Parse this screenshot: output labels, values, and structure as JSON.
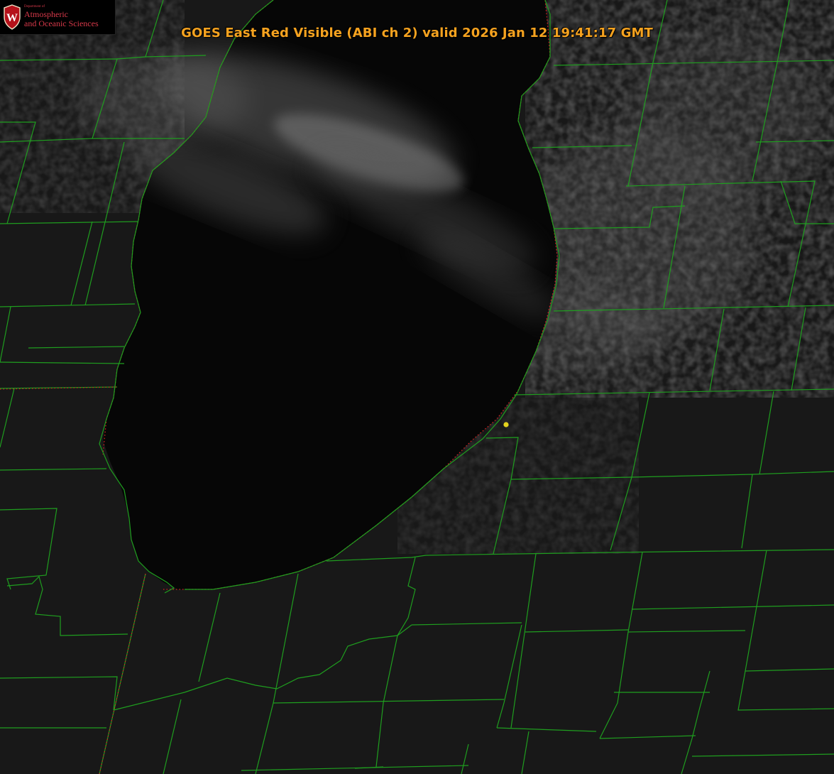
{
  "title": "GOES East Red Visible (ABI ch 2) valid 2026 Jan 12 19:41:17 GMT",
  "logo": {
    "crest_letter": "W",
    "department": "Department of",
    "line1": "Atmospheric",
    "line2": "and Oceanic Sciences"
  },
  "colors": {
    "title": "#f5a21f",
    "boundaries": "#1f9e1f",
    "shoreline_dotted": "#d81f1f",
    "marker": "#e3d21e",
    "logo_text": "#d8394a",
    "crest": "#b5121b",
    "land": "#181818",
    "lake": "#060606",
    "clouds": "#9a9a9a"
  },
  "icons": {
    "crest": "uw-crest-icon",
    "marker": "station-marker-icon"
  }
}
